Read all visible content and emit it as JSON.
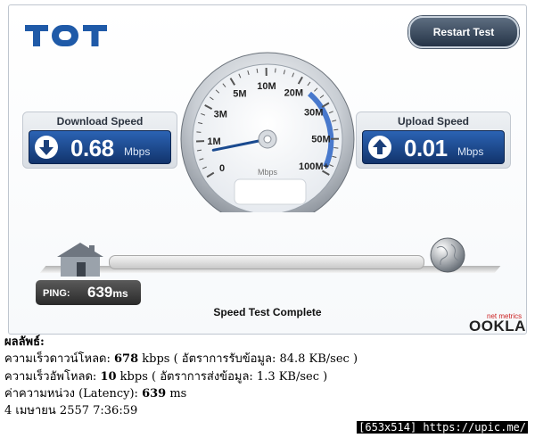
{
  "logo": {
    "text": "TOT"
  },
  "restart_button": {
    "label": "Restart Test"
  },
  "gauge": {
    "ticks": [
      "0",
      "1M",
      "3M",
      "5M",
      "10M",
      "20M",
      "30M",
      "50M",
      "100M+"
    ],
    "unit": "Mbps",
    "needle_value_mbps": 0.68
  },
  "download": {
    "title": "Download Speed",
    "value": "0.68",
    "unit": "Mbps",
    "icon": "arrow-down-icon"
  },
  "upload": {
    "title": "Upload Speed",
    "value": "0.01",
    "unit": "Mbps",
    "icon": "arrow-up-icon"
  },
  "ping": {
    "label": "PING:",
    "value": "639",
    "unit": "ms"
  },
  "status": "Speed Test Complete",
  "brand": {
    "small": "net metrics",
    "name": "OOKLA"
  },
  "result": {
    "heading": "ผลลัพธ์:",
    "lines": [
      {
        "pre": "ความเร็วดาวน์โหลด: ",
        "bold": "678",
        "post": " kbps ( อัตราการรับข้อมูล: 84.8 KB/sec )"
      },
      {
        "pre": "ความเร็วอัพโหลด: ",
        "bold": "10",
        "post": " kbps ( อัตราการส่งข้อมูล: 1.3 KB/sec )"
      },
      {
        "pre": "ค่าความหน่วง (Latency): ",
        "bold": "639",
        "post": " ms"
      },
      {
        "pre": "4 เมษายน 2557 7:36:59",
        "bold": "",
        "post": ""
      }
    ]
  },
  "footer": "[653x514] https://upic.me/",
  "colors": {
    "accent_blue": "#1a4a8f",
    "logo_blue": "#1f5aa8",
    "ookla_red": "#cc2222"
  }
}
